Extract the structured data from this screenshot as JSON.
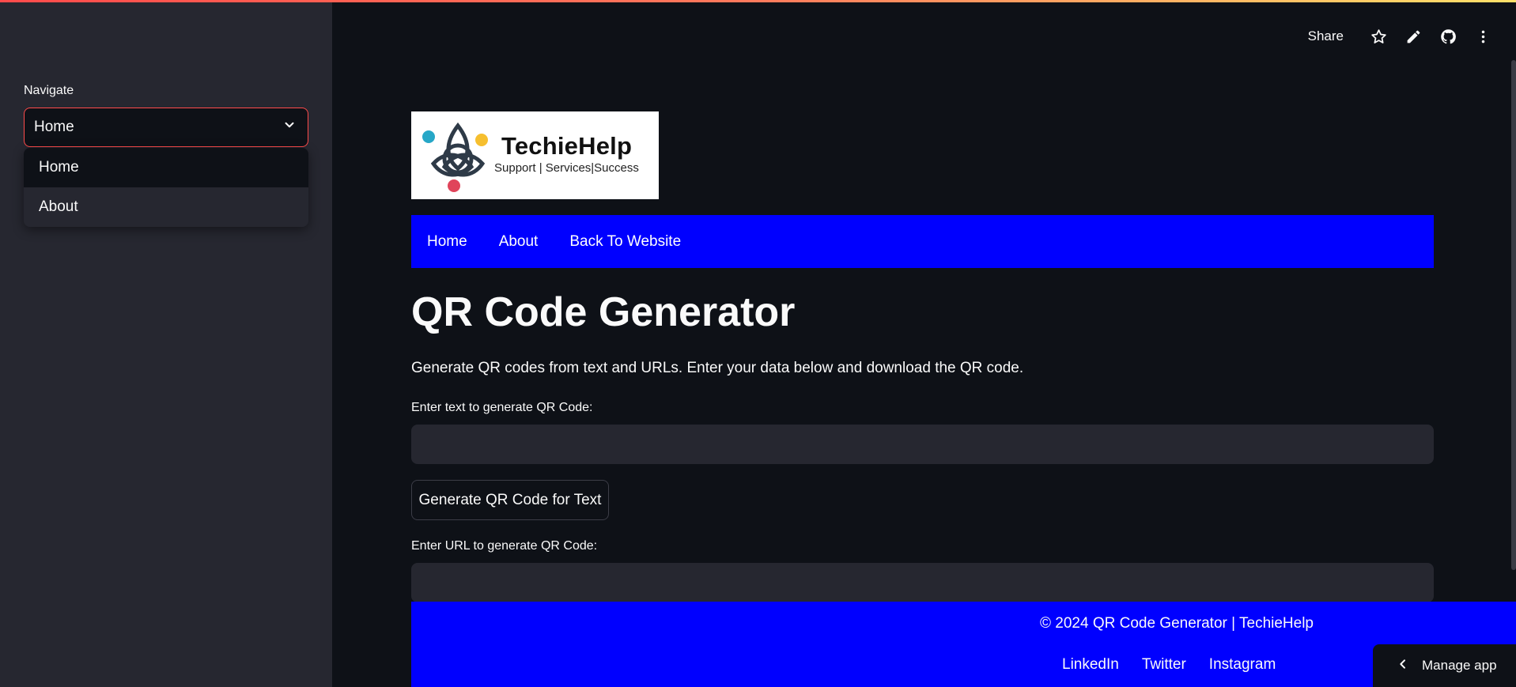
{
  "sidebar": {
    "nav_label": "Navigate",
    "select_value": "Home",
    "options": [
      "Home",
      "About"
    ]
  },
  "toolbar": {
    "share_label": "Share",
    "icons": [
      "star-icon",
      "pencil-icon",
      "github-icon",
      "more-vertical-icon"
    ]
  },
  "logo": {
    "brand": "TechieHelp",
    "tagline": "Support | Services|Success"
  },
  "navbar": {
    "items": [
      "Home",
      "About",
      "Back To Website"
    ]
  },
  "main": {
    "title": "QR Code Generator",
    "subtitle": "Generate QR codes from text and URLs. Enter your data below and download the QR code.",
    "text_label": "Enter text to generate QR Code:",
    "text_value": "",
    "generate_text_button": "Generate QR Code for Text",
    "url_label": "Enter URL to generate QR Code:",
    "url_value": ""
  },
  "footer": {
    "copyright": "© 2024 QR Code Generator | TechieHelp",
    "links": [
      "LinkedIn",
      "Twitter",
      "Instagram"
    ]
  },
  "manage_app": {
    "label": "Manage app"
  },
  "colors": {
    "accent": "#ff4b4b",
    "nav_blue": "#0000ff",
    "background": "#0e1117",
    "sidebar": "#262730"
  }
}
